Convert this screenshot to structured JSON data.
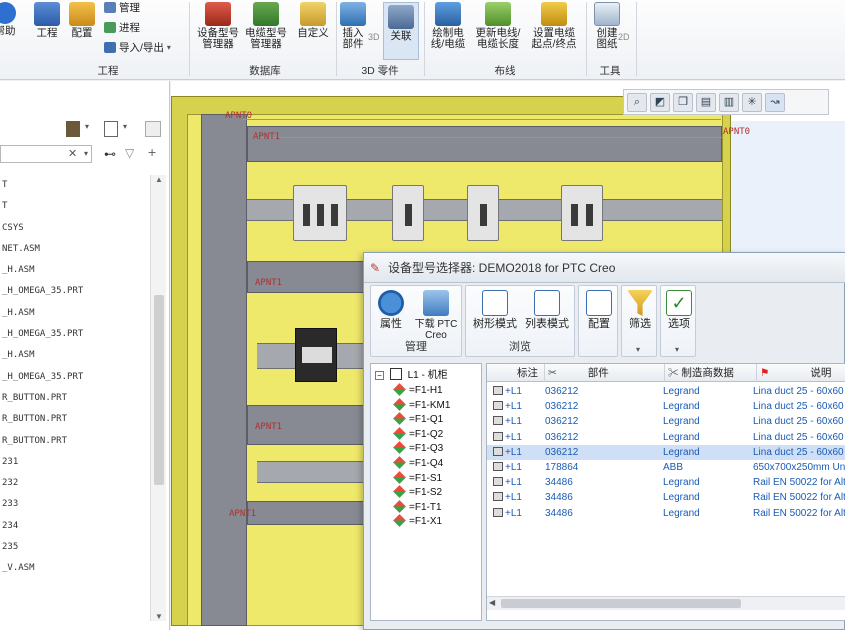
{
  "ribbon": {
    "items": [
      {
        "label": "帮助",
        "icon": "help-icon"
      },
      {
        "label": "工程",
        "icon": "project-icon"
      },
      {
        "label": "配置",
        "icon": "config-icon"
      },
      {
        "label": "设备型号\n管理器",
        "icon": "device-model-icon"
      },
      {
        "label": "电缆型号\n管理器",
        "icon": "cable-model-icon"
      },
      {
        "label": "自定义",
        "icon": "custom-icon"
      },
      {
        "label": "插入\n部件",
        "icon": "insert-part-icon"
      },
      {
        "label": "关联",
        "icon": "link-icon"
      },
      {
        "label": "绘制电\n线/电缆",
        "icon": "draw-wire-icon"
      },
      {
        "label": "更新电线/\n电缆长度",
        "icon": "update-length-icon"
      },
      {
        "label": "设置电缆\n起点/终点",
        "icon": "set-endpoints-icon"
      },
      {
        "label": "创建\n图纸",
        "icon": "create-drawing-icon"
      }
    ],
    "small_cmds": [
      "管理",
      "进程",
      "导入/导出"
    ],
    "groups": [
      "工程",
      "数据库",
      "3D 零件",
      "布线",
      "工具"
    ],
    "label_3d": "3D",
    "label_2d": "2D"
  },
  "left_panel": {
    "items": [
      "T",
      "T",
      "CSYS",
      "NET.ASM",
      "_H.ASM",
      "_H_OMEGA_35.PRT",
      "_H.ASM",
      "_H_OMEGA_35.PRT",
      "_H.ASM",
      "_H_OMEGA_35.PRT",
      "R_BUTTON.PRT",
      "R_BUTTON.PRT",
      "R_BUTTON.PRT",
      "231",
      "232",
      "233",
      "234",
      "235",
      "_V.ASM"
    ]
  },
  "viewport": {
    "apnt_labels": [
      "APNT0",
      "APNT0",
      "APNT1",
      "APNT1",
      "APNT1",
      "APNT1"
    ]
  },
  "dialog": {
    "title": "设备型号选择器: DEMO2018 for PTC Creo",
    "buttons": [
      {
        "label": "属性",
        "icon": "properties-icon"
      },
      {
        "label": "下载 PTC\nCreo",
        "icon": "download-icon"
      },
      {
        "label": "树形模式",
        "icon": "tree-mode-icon"
      },
      {
        "label": "列表模式",
        "icon": "list-mode-icon"
      },
      {
        "label": "配置",
        "icon": "config-icon"
      },
      {
        "label": "筛选",
        "icon": "filter-icon"
      },
      {
        "label": "选项",
        "icon": "options-icon"
      }
    ],
    "groups": [
      "管理",
      "浏览"
    ],
    "tree": {
      "root": "L1 - 机柜",
      "children": [
        "=F1-H1",
        "=F1-KM1",
        "=F1-Q1",
        "=F1-Q2",
        "=F1-Q3",
        "=F1-Q4",
        "=F1-S1",
        "=F1-S2",
        "=F1-T1",
        "=F1-X1"
      ]
    },
    "table": {
      "headers": [
        "标注",
        "部件",
        "制造商数据",
        "说明"
      ],
      "rows": [
        {
          "tag": "+L1",
          "part": "036212",
          "maker": "Legrand",
          "desc": "Lina duct 25 - 60x60"
        },
        {
          "tag": "+L1",
          "part": "036212",
          "maker": "Legrand",
          "desc": "Lina duct 25 - 60x60"
        },
        {
          "tag": "+L1",
          "part": "036212",
          "maker": "Legrand",
          "desc": "Lina duct 25 - 60x60"
        },
        {
          "tag": "+L1",
          "part": "036212",
          "maker": "Legrand",
          "desc": "Lina duct 25 - 60x60"
        },
        {
          "tag": "+L1",
          "part": "036212",
          "maker": "Legrand",
          "desc": "Lina duct 25 - 60x60",
          "selected": true
        },
        {
          "tag": "+L1",
          "part": "178864",
          "maker": "ABB",
          "desc": "650x700x250mm Unit"
        },
        {
          "tag": "+L1",
          "part": "34486",
          "maker": "Legrand",
          "desc": "Rail EN 50022 for Alt"
        },
        {
          "tag": "+L1",
          "part": "34486",
          "maker": "Legrand",
          "desc": "Rail EN 50022 for Alt"
        },
        {
          "tag": "+L1",
          "part": "34486",
          "maker": "Legrand",
          "desc": "Rail EN 50022 for Alt"
        }
      ]
    }
  },
  "colors": {
    "cabinet": "#efe96b",
    "duct": "#878a92",
    "selection": "#cfe0f6",
    "link_text": "#1a5bb5"
  }
}
